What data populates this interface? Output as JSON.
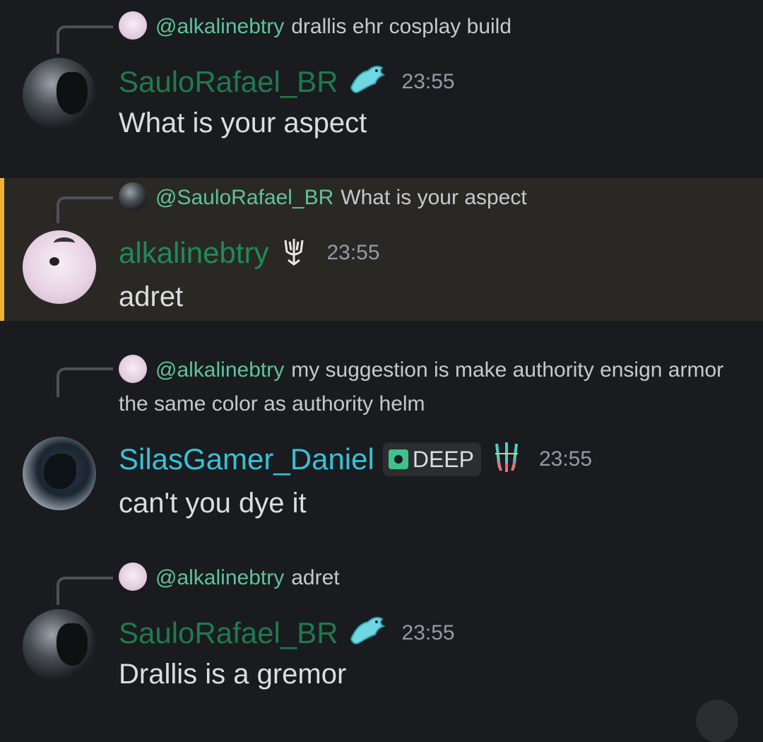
{
  "messages": [
    {
      "reply": {
        "mention": "@alkalinebtry",
        "text": "drallis ehr cosplay build"
      },
      "author": "SauloRafael_BR",
      "badge": "dragon-icon",
      "time": "23:55",
      "content": "What is your aspect"
    },
    {
      "reply": {
        "mention": "@SauloRafael_BR",
        "text": "What is your aspect"
      },
      "author": "alkalinebtry",
      "badge": "trident-icon",
      "time": "23:55",
      "content": "adret",
      "highlighted": true
    },
    {
      "reply": {
        "mention": "@alkalinebtry",
        "text": "my suggestion is make authority ensign armor the same color as authority helm"
      },
      "author": "SilasGamer_Daniel",
      "tag": "DEEP",
      "badge": "claw-icon",
      "time": "23:55",
      "content": "can't you dye it"
    },
    {
      "reply": {
        "mention": "@alkalinebtry",
        "text": "adret"
      },
      "author": "SauloRafael_BR",
      "badge": "dragon-icon",
      "time": "23:55",
      "content": "Drallis is a gremor"
    }
  ],
  "colors": {
    "background": "#1a1b1f",
    "highlight_bg": "#2a2824",
    "highlight_bar": "#f0b232",
    "mention": "#5dc49a",
    "author_green": "#1f7a4d",
    "author_cyan": "#35c3d5",
    "timestamp": "#949ba4"
  }
}
